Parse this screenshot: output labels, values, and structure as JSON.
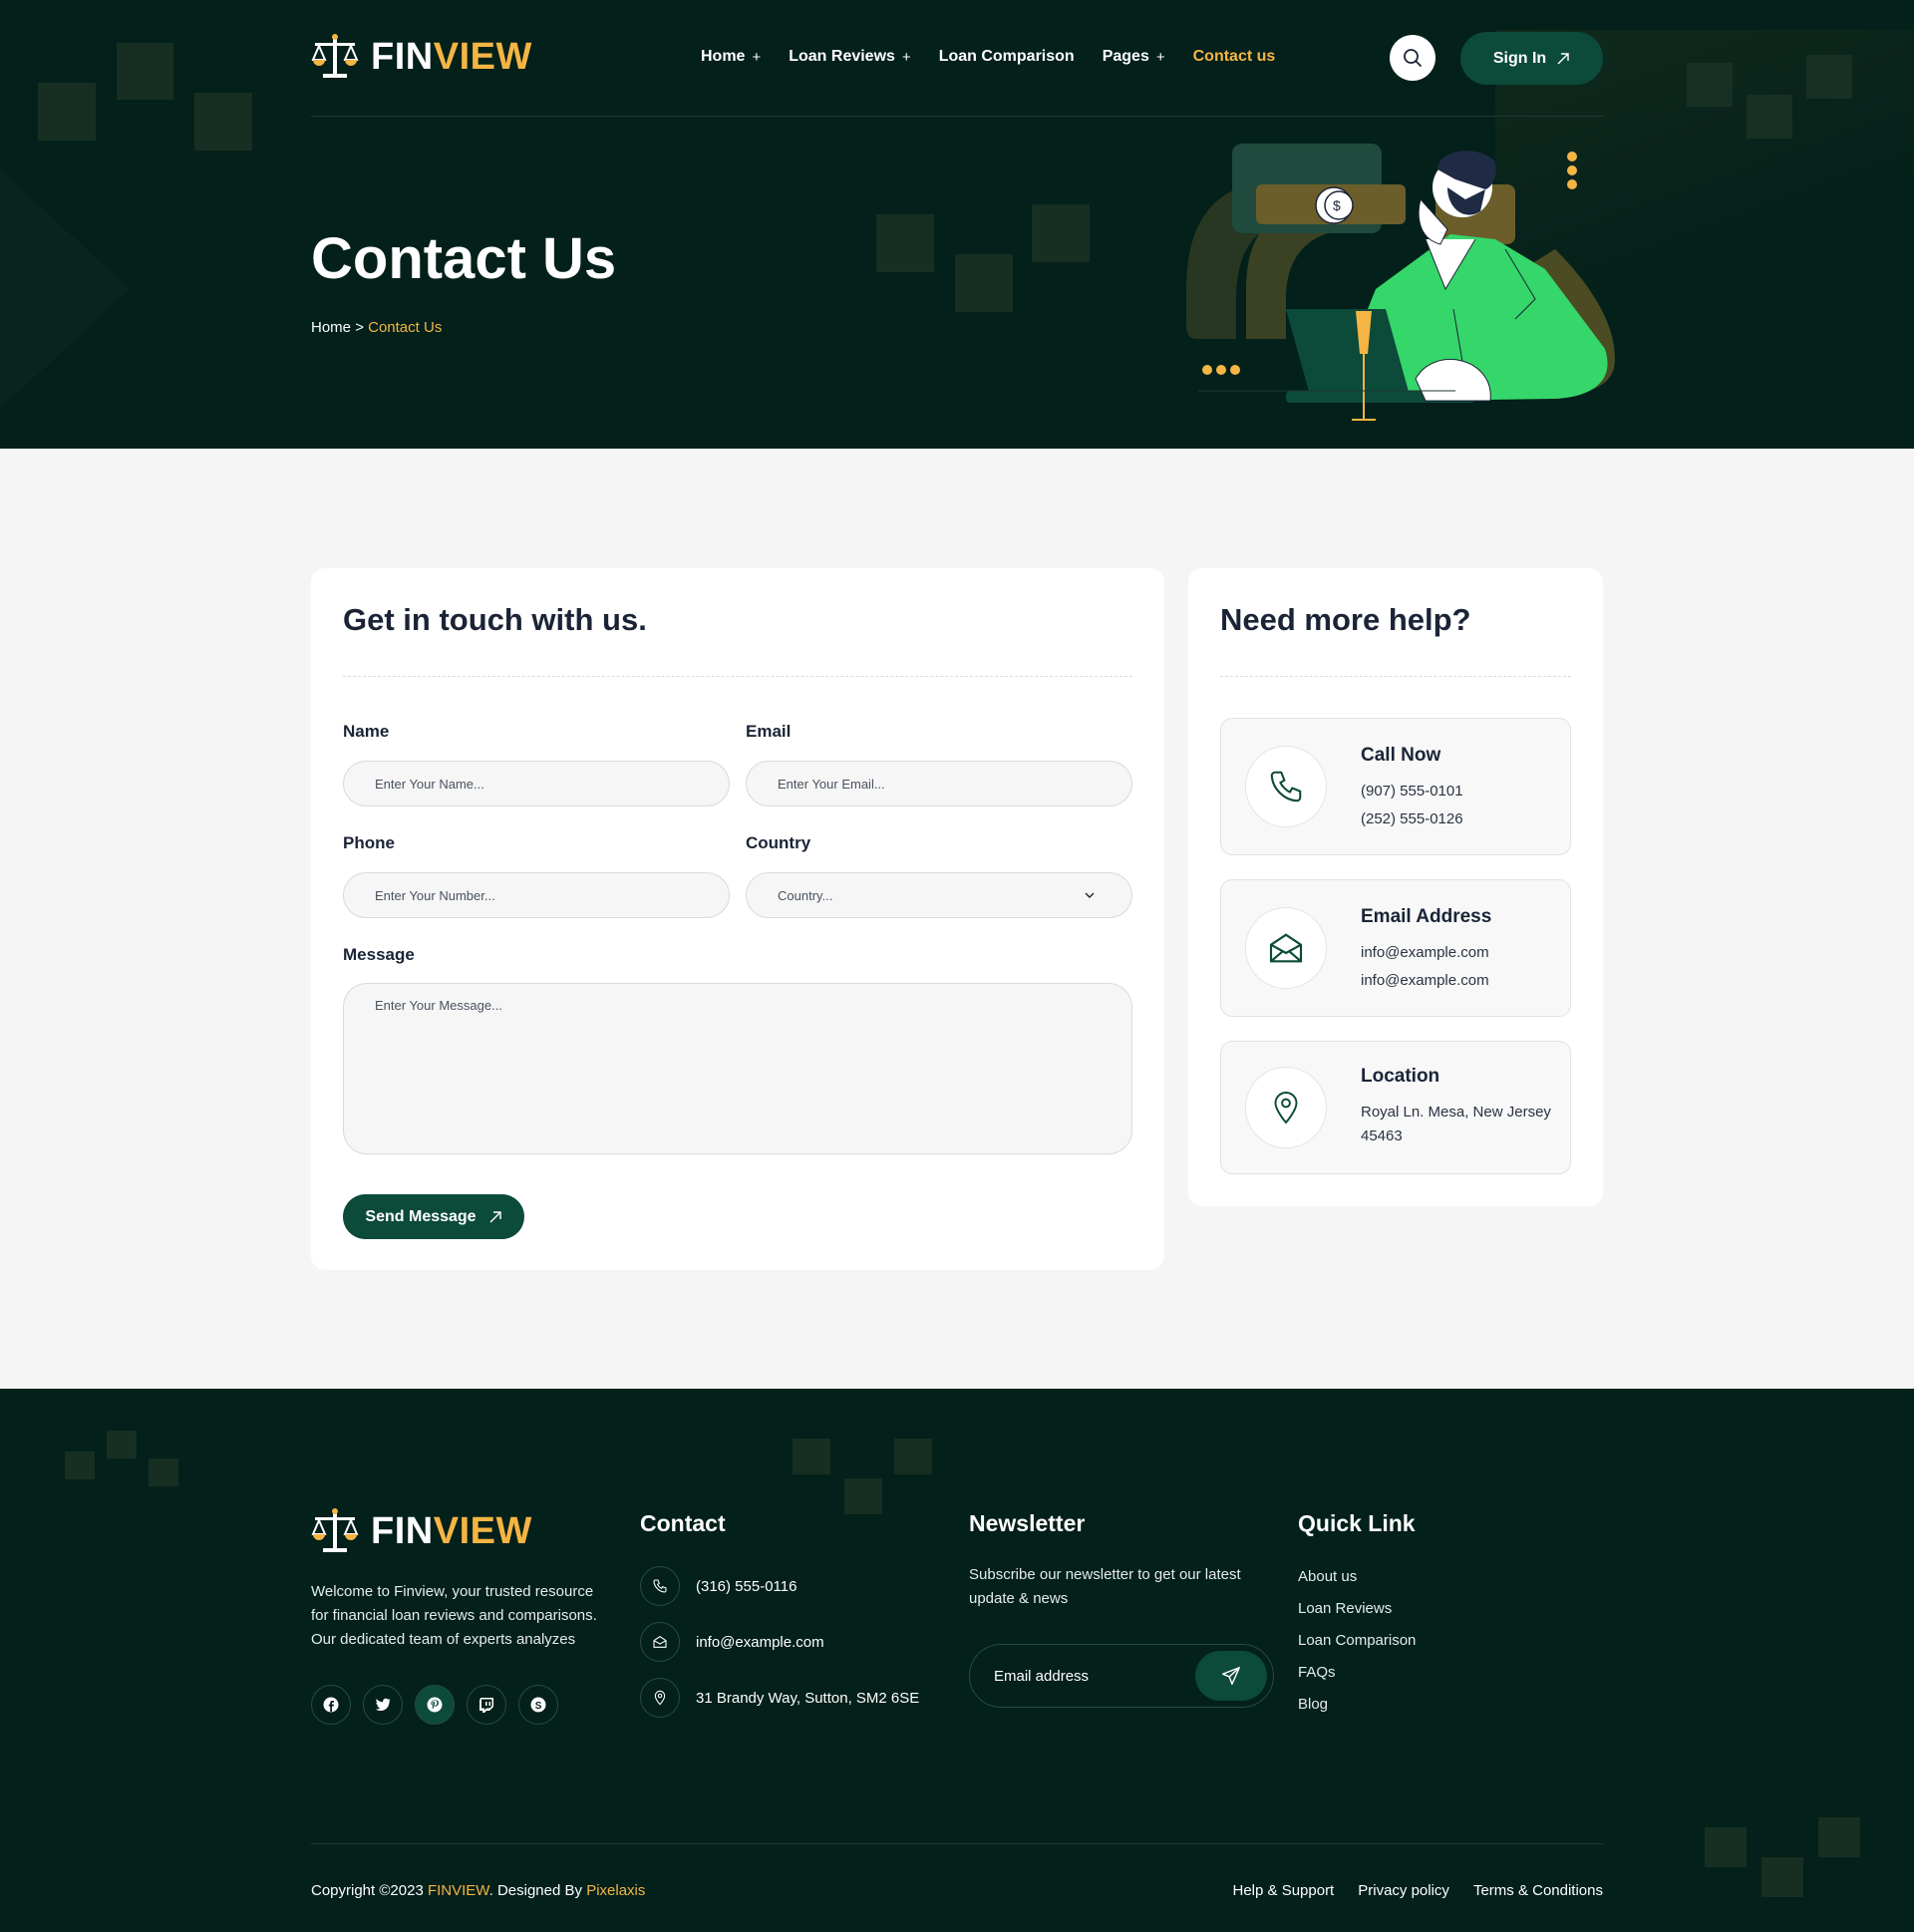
{
  "brand": {
    "part1": "FIN",
    "part2": "VIEW",
    "accent": "#f5b544",
    "primary": "#0c4a3a",
    "dark_bg": "#03201a"
  },
  "nav": {
    "items": [
      {
        "label": "Home",
        "has_submenu": true
      },
      {
        "label": "Loan Reviews",
        "has_submenu": true
      },
      {
        "label": "Loan Comparison",
        "has_submenu": false
      },
      {
        "label": "Pages",
        "has_submenu": true
      },
      {
        "label": "Contact us",
        "has_submenu": false,
        "active": true
      }
    ],
    "submenu_glyph": "+",
    "search_icon": "search-icon",
    "signin_label": "Sign In"
  },
  "hero": {
    "title": "Contact Us",
    "breadcrumb": {
      "home": "Home",
      "sep": ">",
      "current": "Contact Us"
    }
  },
  "form": {
    "title": "Get in touch with us.",
    "name": {
      "label": "Name",
      "placeholder": "Enter Your Name..."
    },
    "email": {
      "label": "Email",
      "placeholder": "Enter Your Email..."
    },
    "phone": {
      "label": "Phone",
      "placeholder": "Enter Your Number..."
    },
    "country": {
      "label": "Country",
      "placeholder": "Country..."
    },
    "message": {
      "label": "Message",
      "placeholder": "Enter Your Message..."
    },
    "submit_label": "Send Message"
  },
  "help": {
    "title": "Need more help?",
    "call": {
      "title": "Call Now",
      "lines": [
        "(907) 555-0101",
        "(252) 555-0126"
      ]
    },
    "email": {
      "title": "Email Address",
      "lines": [
        "info@example.com",
        "info@example.com"
      ]
    },
    "location": {
      "title": "Location",
      "lines": [
        "Royal Ln. Mesa, New Jersey",
        "45463"
      ]
    }
  },
  "footer": {
    "about": "Welcome to Finview, your trusted resource for financial loan reviews and comparisons. Our dedicated team of experts analyzes",
    "socials": [
      "facebook-icon",
      "twitter-icon",
      "pinterest-icon",
      "twitch-icon",
      "skype-icon"
    ],
    "contact": {
      "title": "Contact",
      "phone": "(316) 555-0116",
      "email": "info@example.com",
      "address": "31 Brandy Way, Sutton, SM2 6SE"
    },
    "newsletter": {
      "title": "Newsletter",
      "text": "Subscribe our newsletter to get our latest update & news",
      "placeholder": "Email address"
    },
    "quick_links": {
      "title": "Quick Link",
      "items": [
        "About us",
        "Loan Reviews",
        "Loan Comparison",
        "FAQs",
        "Blog"
      ]
    },
    "copyright": {
      "prefix": "Copyright ©2023 ",
      "brand": "FINVIEW",
      "mid": ". Designed By ",
      "designer": "Pixelaxis"
    },
    "legal": [
      "Help & Support",
      "Privacy policy",
      "Terms & Conditions"
    ]
  }
}
